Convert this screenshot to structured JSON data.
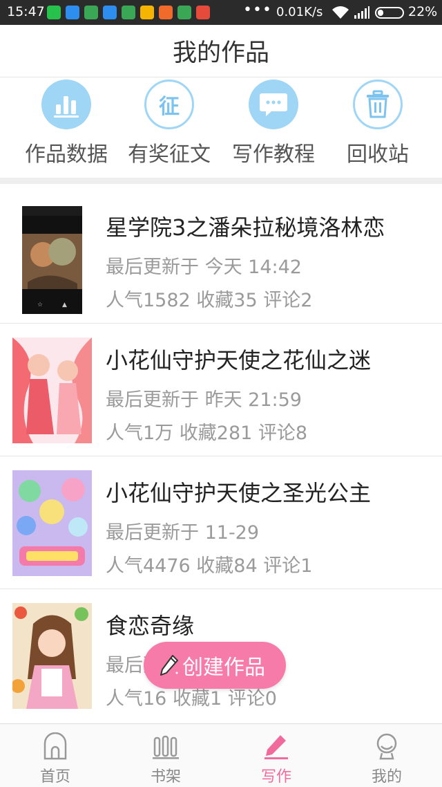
{
  "status_bar": {
    "time": "15:47",
    "more": "•••",
    "network_speed": "0.01K/s",
    "battery": "22%",
    "app_icons": [
      {
        "name": "wechat-icon",
        "color": "#27c24c",
        "glyph": ""
      },
      {
        "name": "app-blue-icon",
        "color": "#2d8ef0",
        "glyph": ""
      },
      {
        "name": "app-green-icon",
        "color": "#3aa757",
        "glyph": ""
      },
      {
        "name": "app-blue-icon",
        "color": "#2d8ef0",
        "glyph": ""
      },
      {
        "name": "app-green-icon",
        "color": "#3aa757",
        "glyph": ""
      },
      {
        "name": "app-yellow-icon",
        "color": "#f5b400",
        "glyph": ""
      },
      {
        "name": "app-orange-icon",
        "color": "#f06a2c",
        "glyph": ""
      },
      {
        "name": "app-green-icon",
        "color": "#3aa757",
        "glyph": ""
      },
      {
        "name": "app-red-icon",
        "color": "#e64a3b",
        "glyph": ""
      }
    ]
  },
  "header": {
    "title": "我的作品"
  },
  "quick_actions": [
    {
      "label": "作品数据",
      "icon": "bar-chart-icon"
    },
    {
      "label": "有奖征文",
      "icon": "contest-icon",
      "glyph": "征"
    },
    {
      "label": "写作教程",
      "icon": "chat-bubble-icon"
    },
    {
      "label": "回收站",
      "icon": "trash-icon"
    }
  ],
  "works": [
    {
      "title": "星学院3之潘朵拉秘境洛林恋",
      "updated": "最后更新于 今天 14:42",
      "stats": "人气1582 收藏35 评论2"
    },
    {
      "title": "小花仙守护天使之花仙之迷",
      "updated": "最后更新于 昨天 21:59",
      "stats": "人气1万 收藏281 评论8"
    },
    {
      "title": "小花仙守护天使之圣光公主",
      "updated": "最后更新于 11-29",
      "stats": "人气4476 收藏84 评论1"
    },
    {
      "title": "食恋奇缘",
      "updated": "最后更新于",
      "stats": "人气16 收藏1 评论0"
    }
  ],
  "fab": {
    "label": "创建作品"
  },
  "bottom_nav": [
    {
      "label": "首页",
      "icon": "home-icon"
    },
    {
      "label": "书架",
      "icon": "bookshelf-icon"
    },
    {
      "label": "写作",
      "icon": "pencil-icon",
      "active": true
    },
    {
      "label": "我的",
      "icon": "profile-icon"
    }
  ],
  "colors": {
    "accent_pink": "#f06b9c",
    "icon_blue": "#9fd5f5",
    "text_primary": "#222222",
    "text_secondary": "#9a9a9a"
  }
}
